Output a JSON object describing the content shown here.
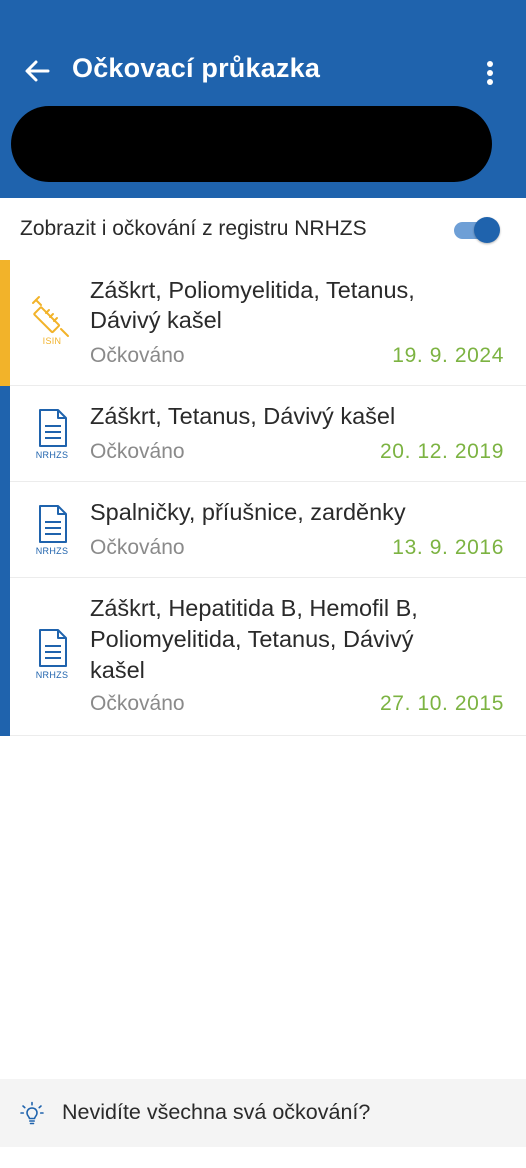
{
  "header": {
    "title": "Očkovací průkazka",
    "back_icon": "arrow-left-icon",
    "more_icon": "more-vertical-icon",
    "color": "#1f63ad"
  },
  "filter": {
    "label": "Zobrazit i očkování z registru NRHZS",
    "enabled": true
  },
  "vaccinations": [
    {
      "name_lines": [
        "Záškrt, Poliomyelitida, Tetanus,",
        "Dávivý kašel"
      ],
      "status": "Očkováno",
      "date": "19. 9. 2024",
      "source": "ISIN",
      "icon": "syringe-icon",
      "accent": "#f2b32a"
    },
    {
      "name_lines": [
        "Záškrt, Tetanus, Dávivý kašel"
      ],
      "status": "Očkováno",
      "date": "20. 12. 2019",
      "source": "NRHZS",
      "icon": "document-icon",
      "accent": "#1f63ad"
    },
    {
      "name_lines": [
        "Spalničky, příušnice, zarděnky"
      ],
      "status": "Očkováno",
      "date": "13. 9. 2016",
      "source": "NRHZS",
      "icon": "document-icon",
      "accent": "#1f63ad"
    },
    {
      "name_lines": [
        "Záškrt, Hepatitida B, Hemofil B,",
        "Poliomyelitida, Tetanus, Dávivý",
        "kašel"
      ],
      "status": "Očkováno",
      "date": "27. 10. 2015",
      "source": "NRHZS",
      "icon": "document-icon",
      "accent": "#1f63ad"
    }
  ],
  "footer": {
    "text": "Nevidíte všechna svá očkování?",
    "icon": "lightbulb-icon"
  },
  "colors": {
    "date_green": "#7cb342",
    "isin_yellow": "#f2b32a"
  }
}
